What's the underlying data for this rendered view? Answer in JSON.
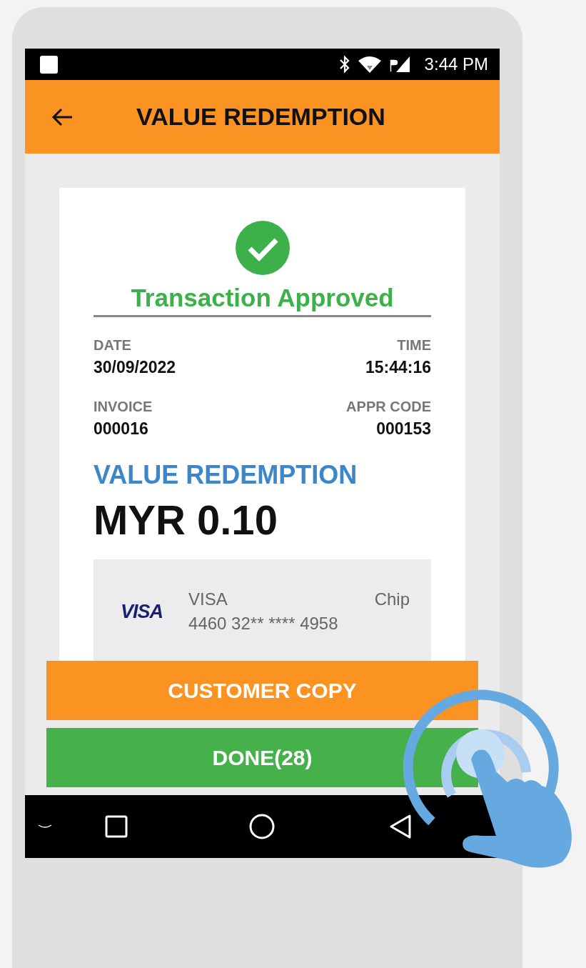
{
  "status_bar": {
    "time": "3:44 PM"
  },
  "header": {
    "title": "VALUE REDEMPTION"
  },
  "receipt": {
    "status": "Transaction Approved",
    "fields": [
      {
        "label": "DATE",
        "value": "30/09/2022"
      },
      {
        "label": "TIME",
        "value": "15:44:16"
      },
      {
        "label": "INVOICE",
        "value": "000016"
      },
      {
        "label": "APPR CODE",
        "value": "000153"
      }
    ],
    "transaction_type": "VALUE REDEMPTION",
    "amount": "MYR 0.10",
    "card": {
      "logo": "VISA",
      "brand": "VISA",
      "number": "4460 32** **** 4958",
      "entry_mode": "Chip"
    }
  },
  "buttons": [
    {
      "label": "CUSTOMER COPY",
      "color": "#fb9322"
    },
    {
      "label": "DONE(28)",
      "color": "#46b04a"
    }
  ]
}
